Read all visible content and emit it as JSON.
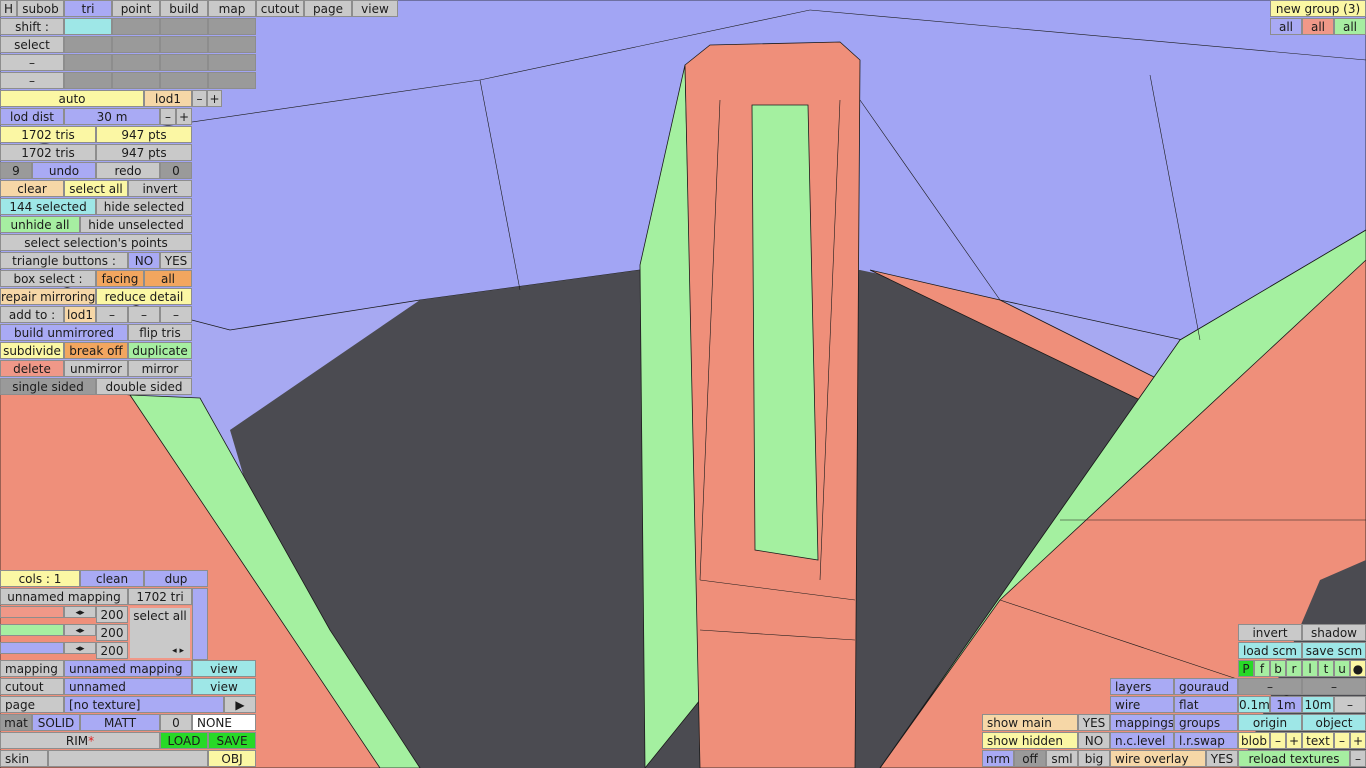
{
  "top_tabs": {
    "h": "H",
    "subob": "subob",
    "tri": "tri",
    "point": "point",
    "build": "build",
    "map": "map",
    "cutout": "cutout",
    "page": "page",
    "view": "view"
  },
  "rows": {
    "shift": "shift :",
    "select": "select",
    "dash": "–"
  },
  "lod": {
    "auto": "auto",
    "level": "lod1",
    "minus": "–",
    "plus": "+",
    "dist_label": "lod dist",
    "dist_value": "30 m"
  },
  "stats": {
    "tris1": "1702 tris",
    "pts1": "947 pts",
    "tris2": "1702 tris",
    "pts2": "947 pts"
  },
  "history": {
    "undo_count": "9",
    "undo": "undo",
    "redo": "redo",
    "redo_count": "0"
  },
  "selection": {
    "clear": "clear",
    "select_all": "select all",
    "invert": "invert",
    "selected": "144 selected",
    "hide_selected": "hide selected",
    "unhide_all": "unhide all",
    "hide_unselected": "hide unselected",
    "select_points": "select selection's points"
  },
  "triangle_buttons": {
    "label": "triangle buttons :",
    "no": "NO",
    "yes": "YES"
  },
  "box_select": {
    "label": "box select :",
    "facing": "facing",
    "all": "all"
  },
  "ops": {
    "repair_mirroring": "repair mirroring",
    "reduce_detail": "reduce detail",
    "add_to": "add to :",
    "add_lod": "lod1",
    "dash": "–",
    "build_unmirrored": "build unmirrored",
    "flip_tris": "flip tris",
    "subdivide": "subdivide",
    "break_off": "break off",
    "duplicate": "duplicate",
    "delete": "delete",
    "unmirror": "unmirror",
    "mirror": "mirror",
    "single_sided": "single sided",
    "double_sided": "double sided"
  },
  "group": {
    "title": "new group (3)",
    "all": "all"
  },
  "cols": {
    "label": "cols : 1",
    "clean": "clean",
    "dup": "dup",
    "mapping_name": "unnamed mapping",
    "tri_count": "1702 tri",
    "v1": "200",
    "v2": "200",
    "v3": "200",
    "select_all": "select all",
    "arrow_left": "◂",
    "arrow_right": "▸"
  },
  "mapping": {
    "mapping_label": "mapping",
    "mapping_value": "unnamed mapping",
    "view": "view",
    "cutout_label": "cutout",
    "cutout_value": "unnamed",
    "page_label": "page",
    "page_value": "[no texture]",
    "page_arrow": "▶",
    "mat": "mat",
    "solid": "SOLID",
    "matt": "MATT",
    "zero": "0",
    "none": "NONE",
    "rim": "RIM",
    "asterisk": "*",
    "load": "LOAD",
    "save": "SAVE",
    "skin": "skin",
    "obj": "OBJ"
  },
  "bottom": {
    "show_main": "show main",
    "show_main_val": "YES",
    "show_hidden": "show hidden",
    "show_hidden_val": "NO",
    "nrm": "nrm",
    "off": "off",
    "sml": "sml",
    "big": "big",
    "layers": "layers",
    "gouraud": "gouraud",
    "wire": "wire",
    "flat": "flat",
    "mappings": "mappings",
    "groups": "groups",
    "nclevel": "n.c.level",
    "lrswap": "l.r.swap",
    "wire_overlay": "wire overlay",
    "wire_overlay_val": "YES"
  },
  "right": {
    "invert": "invert",
    "shadow": "shadow",
    "load_scm": "load scm",
    "save_scm": "save scm",
    "flags": [
      "P",
      "f",
      "b",
      "r",
      "l",
      "t",
      "u",
      "●"
    ],
    "dash": "–",
    "d01": "0.1m",
    "d1": "1m",
    "d10": "10m",
    "origin": "origin",
    "object": "object",
    "blob": "blob",
    "minus": "–",
    "plus": "+",
    "text": "text",
    "reload": "reload textures"
  },
  "colors": {
    "sky": "#a7a9f2",
    "salmon": "#ef8f7a",
    "green": "#a4f0a0",
    "floor": "#4a4a50",
    "wire": "#1a1a1a"
  }
}
